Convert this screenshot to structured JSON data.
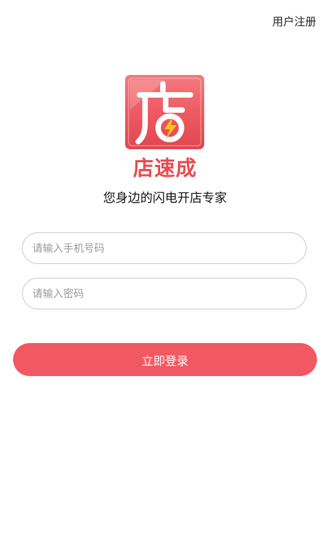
{
  "header": {
    "register_label": "用户注册"
  },
  "brand": {
    "logo_icon": "store-lightning-logo-icon",
    "logo_glyph": "店",
    "name": "店速成",
    "slogan": "您身边的闪电开店专家"
  },
  "form": {
    "phone_placeholder": "请输入手机号码",
    "phone_value": "",
    "password_placeholder": "请输入密码",
    "password_value": "",
    "login_label": "立即登录"
  },
  "colors": {
    "accent": "#f15862",
    "brand_text": "#e84a4f",
    "logo_bg": "#ee5a62",
    "bolt": "#f8c41a"
  }
}
